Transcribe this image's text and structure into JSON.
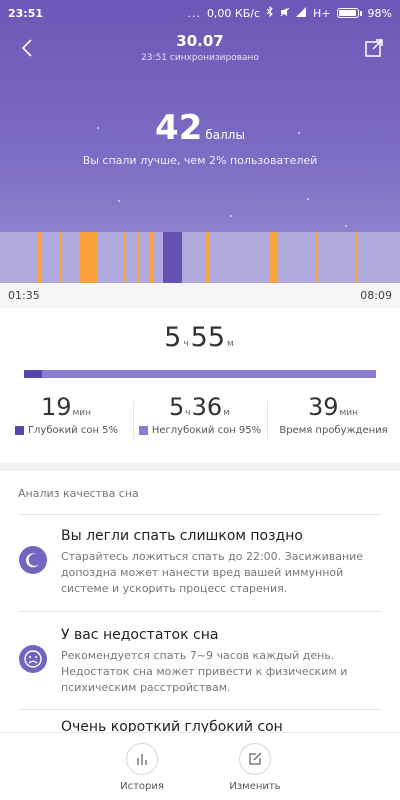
{
  "status_bar": {
    "time": "23:51",
    "dots": "...",
    "network_speed": "0,00 КБ/с",
    "signal": "H+",
    "battery": "98%"
  },
  "header": {
    "date": "30.07",
    "sync": "23:51 синхронизировано",
    "back_icon": "back-arrow-icon",
    "share_icon": "share-icon"
  },
  "score": {
    "value": "42",
    "unit": "баллы",
    "subtitle": "Вы спали лучше, чем 2% пользователей"
  },
  "timeline": {
    "start": "01:35",
    "end": "08:09",
    "colors": {
      "light": "#b2a9dd",
      "awake": "#f9a13a",
      "deep": "#6552b1"
    }
  },
  "total": {
    "hours": "5",
    "hours_unit": "ч",
    "minutes": "55",
    "minutes_unit": "м",
    "deep_fraction": 0.05
  },
  "stats": {
    "deep": {
      "value": "19",
      "unit": "мин",
      "label": "Глубокий сон 5%",
      "color": "#5a46a8"
    },
    "light": {
      "hours": "5",
      "hours_unit": "ч",
      "minutes": "36",
      "minutes_unit": "м",
      "label": "Неглубокий сон 95%",
      "color": "#8a7cd0"
    },
    "awake": {
      "value": "39",
      "unit": "мин",
      "label": "Время пробуждения"
    }
  },
  "analysis": {
    "title": "Анализ качества сна",
    "items": [
      {
        "icon": "moon-icon",
        "title": "Вы легли спать слишком поздно",
        "desc": "Старайтесь ложиться спать до 22:00. Засиживание допоздна может нанести вред вашей иммунной системе и ускорить процесс старения."
      },
      {
        "icon": "sad-face-icon",
        "title": "У вас недостаток сна",
        "desc": "Рекомендуется спать 7~9 часов каждый день. Недостаток сна может привести к физическим и психическим расстройствам."
      },
      {
        "icon": "deep-sleep-icon",
        "title": "Очень короткий глубокий сон",
        "desc": ""
      }
    ]
  },
  "bottom_nav": {
    "history": "История",
    "edit": "Изменить"
  }
}
